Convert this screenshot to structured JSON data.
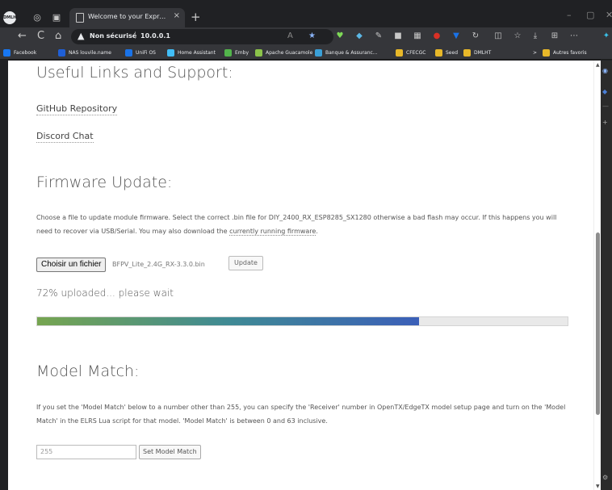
{
  "browser": {
    "profile_label": "DMLHT",
    "tab": {
      "title": "Welcome to your ExpressLRS System",
      "close": "×"
    },
    "new_tab": "+",
    "window_controls": {
      "minimize": "–",
      "maximize": "▢",
      "close": "✕"
    },
    "address": {
      "warning_icon": "▲",
      "security_label": "Non sécurisé",
      "separator": "|",
      "url": "10.0.0.1"
    },
    "nav_icons": {
      "back": "←",
      "refresh": "C",
      "home": "⌂"
    },
    "bookmarks": [
      {
        "label": "Facebook",
        "color": "#1877f2"
      },
      {
        "label": "NAS louvile.name",
        "color": "#1f5fd6"
      },
      {
        "label": "UniFi OS",
        "color": "#1a73e8"
      },
      {
        "label": "Home Assistant",
        "color": "#41bdf5"
      },
      {
        "label": "Emby",
        "color": "#52b54b"
      },
      {
        "label": "Apache Guacamole",
        "color": "#8bc34a"
      },
      {
        "label": "Banque & Assuranc...",
        "color": "#3aa0d8"
      },
      {
        "label": "CFECGC",
        "color": "#e8b829"
      },
      {
        "label": "Seed",
        "color": "#e8b829"
      },
      {
        "label": "DMLHT",
        "color": "#e8b829"
      }
    ],
    "bookmarks_more": ">",
    "other_favorites": "Autres favoris",
    "accent_color": "#8ab4f8"
  },
  "page": {
    "links_heading": "Useful Links and Support:",
    "github_link": "GitHub Repository",
    "discord_link": "Discord Chat",
    "firmware_heading": "Firmware Update:",
    "firmware_text_1": "Choose a file to update module firmware. Select the correct .bin file for DIY_2400_RX_ESP8285_SX1280 otherwise a bad flash may occur. If this happens you will need to recover via USB/Serial. You may also download the ",
    "firmware_link": "currently running firmware",
    "firmware_text_2": ".",
    "choose_file_label": "Choisir un fichier",
    "selected_file": "BFPV_Lite_2.4G_RX-3.3.0.bin",
    "update_label": "Update",
    "upload_status": "72% uploaded... please wait",
    "upload_progress_percent": 72,
    "model_heading": "Model Match:",
    "model_text": "If you set the 'Model Match' below to a number other than 255, you can specify the 'Receiver' number in OpenTX/EdgeTX model setup page and turn on the 'Model Match' in the ELRS Lua script for that model. 'Model Match' is between 0 and 63 inclusive.",
    "model_value": "255",
    "set_model_label": "Set Model Match"
  }
}
